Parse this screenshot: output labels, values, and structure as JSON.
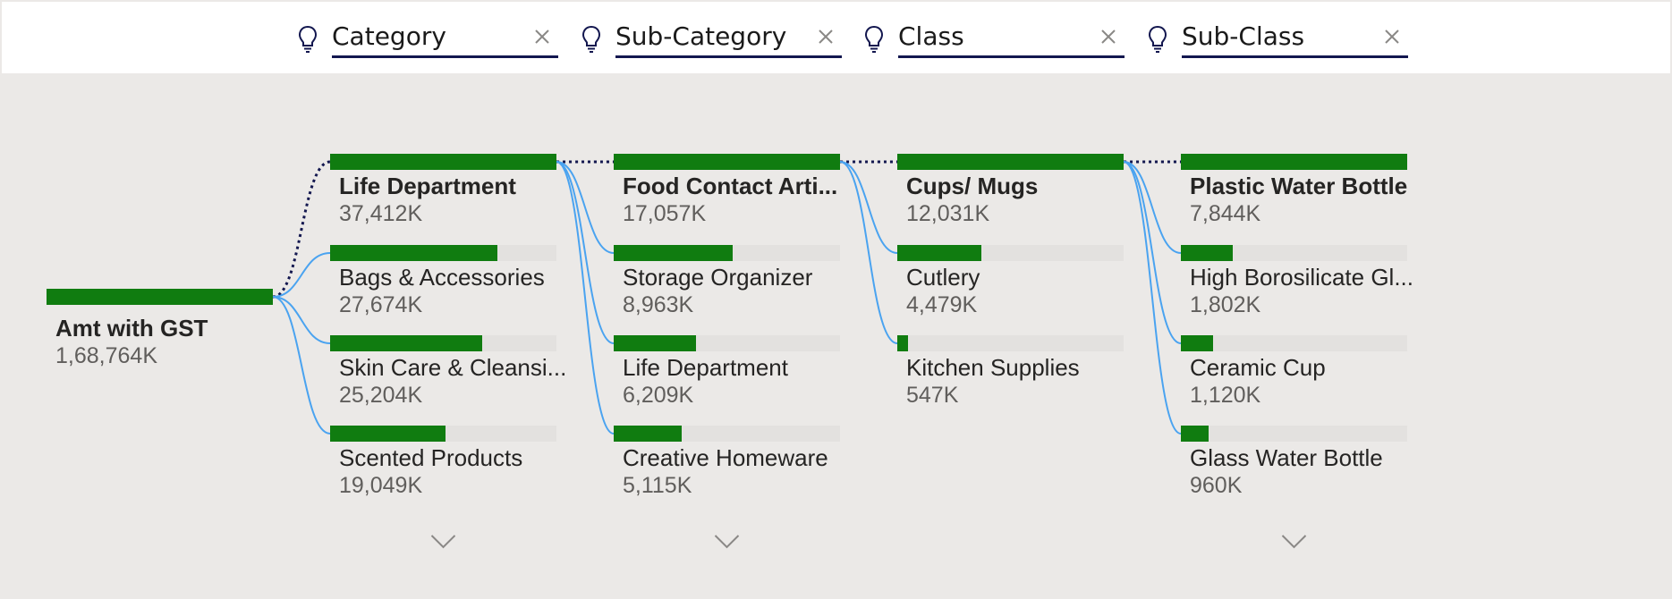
{
  "chart_data": {
    "type": "decomposition-tree",
    "colors": {
      "bar": "#107c10",
      "track": "#e3e1df",
      "link": "#4aa3f0",
      "selected_link": "#13174f",
      "header_underline": "#13174f"
    },
    "root": {
      "label": "Amt with GST",
      "value_text": "1,68,764K",
      "value": 168764
    },
    "levels": [
      {
        "name": "Category",
        "selected_index": 0,
        "has_more": true,
        "nodes": [
          {
            "label": "Life Department",
            "value_text": "37,412K",
            "value": 37412
          },
          {
            "label": "Bags & Accessories",
            "value_text": "27,674K",
            "value": 27674
          },
          {
            "label": "Skin Care & Cleansi...",
            "value_text": "25,204K",
            "value": 25204
          },
          {
            "label": "Scented Products",
            "value_text": "19,049K",
            "value": 19049
          }
        ]
      },
      {
        "name": "Sub-Category",
        "selected_index": 0,
        "has_more": true,
        "nodes": [
          {
            "label": "Food Contact Arti...",
            "value_text": "17,057K",
            "value": 17057
          },
          {
            "label": "Storage Organizer",
            "value_text": "8,963K",
            "value": 8963
          },
          {
            "label": "Life Department",
            "value_text": "6,209K",
            "value": 6209
          },
          {
            "label": "Creative Homeware",
            "value_text": "5,115K",
            "value": 5115
          }
        ]
      },
      {
        "name": "Class",
        "selected_index": 0,
        "has_more": false,
        "nodes": [
          {
            "label": "Cups/ Mugs",
            "value_text": "12,031K",
            "value": 12031
          },
          {
            "label": "Cutlery",
            "value_text": "4,479K",
            "value": 4479
          },
          {
            "label": "Kitchen Supplies",
            "value_text": "547K",
            "value": 547
          }
        ]
      },
      {
        "name": "Sub-Class",
        "selected_index": 0,
        "has_more": true,
        "nodes": [
          {
            "label": "Plastic Water Bottle",
            "value_text": "7,844K",
            "value": 7844
          },
          {
            "label": "High Borosilicate Gl...",
            "value_text": "1,802K",
            "value": 1802
          },
          {
            "label": "Ceramic Cup",
            "value_text": "1,120K",
            "value": 1120
          },
          {
            "label": "Glass Water Bottle",
            "value_text": "960K",
            "value": 960
          }
        ]
      }
    ]
  }
}
